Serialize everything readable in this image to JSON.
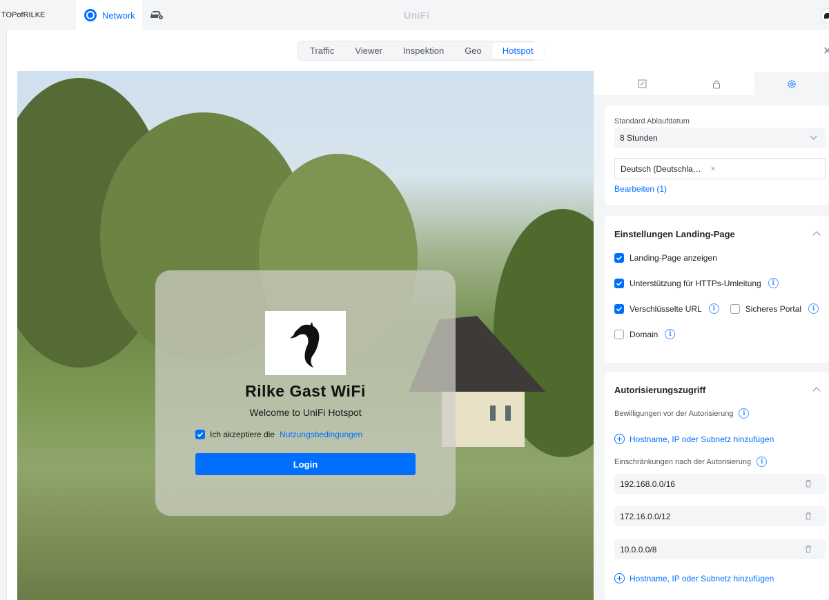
{
  "topbar": {
    "site_name": "TOPofRILKE",
    "network_tab": "Network",
    "brand": "UniFi"
  },
  "tabs": [
    "Traffic",
    "Viewer",
    "Inspektion",
    "Geo",
    "Hotspot"
  ],
  "active_tab": "Hotspot",
  "preview": {
    "title": "Rilke Gast WiFi",
    "subtitle": "Welcome to UniFi Hotspot",
    "terms_prefix": "Ich akzeptiere die",
    "terms_link": "Nutzungsbedingungen",
    "terms_checked": true,
    "login_label": "Login"
  },
  "panel": {
    "tab_icons": [
      "edit-icon",
      "lock-icon",
      "gear-icon"
    ],
    "general": {
      "expiry_label": "Standard Ablaufdatum",
      "expiry_value": "8 Stunden",
      "language_tag": "Deutsch (Deutschla…",
      "tag_remove": "×",
      "edit_link": "Bearbeiten (1)"
    },
    "landing": {
      "title": "Einstellungen Landing-Page",
      "show_landing": "Landing-Page anzeigen",
      "https_redirect": "Unterstützung für HTTPs-Umleitung",
      "encrypted_url": "Verschlüsselte URL",
      "secure_portal": "Sicheres Portal",
      "domain": "Domain",
      "info_glyph": "i"
    },
    "auth": {
      "title": "Autorisierungszugriff",
      "pre_auth_label": "Bewilligungen vor der Autorisierung",
      "add_host_1": "Hostname, IP oder Subnetz hinzufügen",
      "post_auth_label": "Einschränkungen nach der Autorisierung",
      "restrictions": [
        "192.168.0.0/16",
        "172.16.0.0/12",
        "10.0.0.0/8"
      ],
      "add_host_2": "Hostname, IP oder Subnetz hinzufügen"
    }
  },
  "colors": {
    "accent": "#006fff",
    "page_bg": "#f4f5f6"
  }
}
